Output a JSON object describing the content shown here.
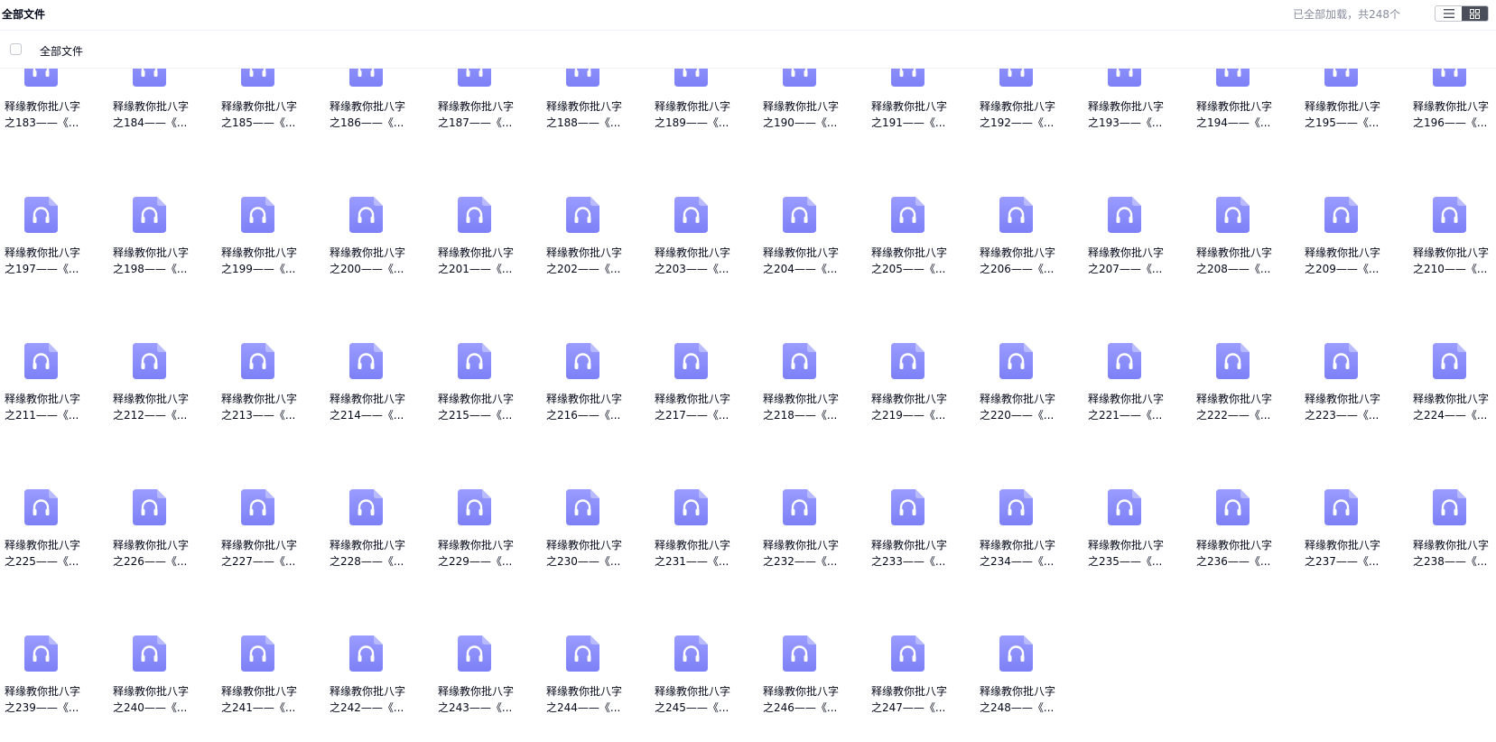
{
  "header": {
    "title": "全部文件",
    "load_status": "已全部加载，共248个",
    "view_list_icon": "list-icon",
    "view_grid_icon": "grid-icon"
  },
  "subheader": {
    "select_all_label": "全部文件"
  },
  "colors": {
    "icon_top": "#9a9cff",
    "icon_bottom": "#7c80f6",
    "accent_dark": "#4a4e5a"
  },
  "files": [
    {
      "line1": "释缘教你批八字",
      "line2": "之183——《..."
    },
    {
      "line1": "释缘教你批八字",
      "line2": "之184——《..."
    },
    {
      "line1": "释缘教你批八字",
      "line2": "之185——《..."
    },
    {
      "line1": "释缘教你批八字",
      "line2": "之186——《..."
    },
    {
      "line1": "释缘教你批八字",
      "line2": "之187——《..."
    },
    {
      "line1": "释缘教你批八字",
      "line2": "之188——《..."
    },
    {
      "line1": "释缘教你批八字",
      "line2": "之189——《..."
    },
    {
      "line1": "释缘教你批八字",
      "line2": "之190——《..."
    },
    {
      "line1": "释缘教你批八字",
      "line2": "之191——《..."
    },
    {
      "line1": "释缘教你批八字",
      "line2": "之192——《..."
    },
    {
      "line1": "释缘教你批八字",
      "line2": "之193——《..."
    },
    {
      "line1": "释缘教你批八字",
      "line2": "之194——《..."
    },
    {
      "line1": "释缘教你批八字",
      "line2": "之195——《..."
    },
    {
      "line1": "释缘教你批八字",
      "line2": "之196——《..."
    },
    {
      "line1": "释缘教你批八字",
      "line2": "之197——《..."
    },
    {
      "line1": "释缘教你批八字",
      "line2": "之198——《..."
    },
    {
      "line1": "释缘教你批八字",
      "line2": "之199——《..."
    },
    {
      "line1": "释缘教你批八字",
      "line2": "之200——《..."
    },
    {
      "line1": "释缘教你批八字",
      "line2": "之201——《..."
    },
    {
      "line1": "释缘教你批八字",
      "line2": "之202——《..."
    },
    {
      "line1": "释缘教你批八字",
      "line2": "之203——《..."
    },
    {
      "line1": "释缘教你批八字",
      "line2": "之204——《..."
    },
    {
      "line1": "释缘教你批八字",
      "line2": "之205——《..."
    },
    {
      "line1": "释缘教你批八字",
      "line2": "之206——《..."
    },
    {
      "line1": "释缘教你批八字",
      "line2": "之207——《..."
    },
    {
      "line1": "释缘教你批八字",
      "line2": "之208——《..."
    },
    {
      "line1": "释缘教你批八字",
      "line2": "之209——《..."
    },
    {
      "line1": "释缘教你批八字",
      "line2": "之210——《..."
    },
    {
      "line1": "释缘教你批八字",
      "line2": "之211——《..."
    },
    {
      "line1": "释缘教你批八字",
      "line2": "之212——《..."
    },
    {
      "line1": "释缘教你批八字",
      "line2": "之213——《..."
    },
    {
      "line1": "释缘教你批八字",
      "line2": "之214——《..."
    },
    {
      "line1": "释缘教你批八字",
      "line2": "之215——《..."
    },
    {
      "line1": "释缘教你批八字",
      "line2": "之216——《..."
    },
    {
      "line1": "释缘教你批八字",
      "line2": "之217——《..."
    },
    {
      "line1": "释缘教你批八字",
      "line2": "之218——《..."
    },
    {
      "line1": "释缘教你批八字",
      "line2": "之219——《..."
    },
    {
      "line1": "释缘教你批八字",
      "line2": "之220——《..."
    },
    {
      "line1": "释缘教你批八字",
      "line2": "之221——《..."
    },
    {
      "line1": "释缘教你批八字",
      "line2": "之222——《..."
    },
    {
      "line1": "释缘教你批八字",
      "line2": "之223——《..."
    },
    {
      "line1": "释缘教你批八字",
      "line2": "之224——《..."
    },
    {
      "line1": "释缘教你批八字",
      "line2": "之225——《..."
    },
    {
      "line1": "释缘教你批八字",
      "line2": "之226——《..."
    },
    {
      "line1": "释缘教你批八字",
      "line2": "之227——《..."
    },
    {
      "line1": "释缘教你批八字",
      "line2": "之228——《..."
    },
    {
      "line1": "释缘教你批八字",
      "line2": "之229——《..."
    },
    {
      "line1": "释缘教你批八字",
      "line2": "之230——《..."
    },
    {
      "line1": "释缘教你批八字",
      "line2": "之231——《..."
    },
    {
      "line1": "释缘教你批八字",
      "line2": "之232——《..."
    },
    {
      "line1": "释缘教你批八字",
      "line2": "之233——《..."
    },
    {
      "line1": "释缘教你批八字",
      "line2": "之234——《..."
    },
    {
      "line1": "释缘教你批八字",
      "line2": "之235——《..."
    },
    {
      "line1": "释缘教你批八字",
      "line2": "之236——《..."
    },
    {
      "line1": "释缘教你批八字",
      "line2": "之237——《..."
    },
    {
      "line1": "释缘教你批八字",
      "line2": "之238——《..."
    },
    {
      "line1": "释缘教你批八字",
      "line2": "之239——《..."
    },
    {
      "line1": "释缘教你批八字",
      "line2": "之240——《..."
    },
    {
      "line1": "释缘教你批八字",
      "line2": "之241——《..."
    },
    {
      "line1": "释缘教你批八字",
      "line2": "之242——《..."
    },
    {
      "line1": "释缘教你批八字",
      "line2": "之243——《..."
    },
    {
      "line1": "释缘教你批八字",
      "line2": "之244——《..."
    },
    {
      "line1": "释缘教你批八字",
      "line2": "之245——《..."
    },
    {
      "line1": "释缘教你批八字",
      "line2": "之246——《..."
    },
    {
      "line1": "释缘教你批八字",
      "line2": "之247——《..."
    },
    {
      "line1": "释缘教你批八字",
      "line2": "之248——《..."
    }
  ]
}
